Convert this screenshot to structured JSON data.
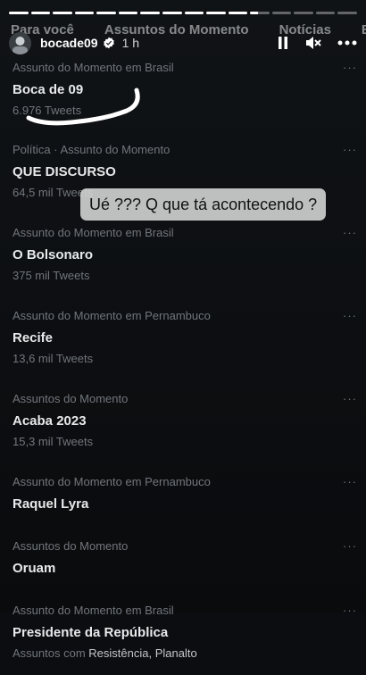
{
  "story": {
    "progress": [
      1,
      1,
      1,
      1,
      1,
      1,
      1,
      1,
      1,
      1,
      1,
      0.4,
      0,
      0,
      0,
      0
    ]
  },
  "background_tabs": [
    "Para você",
    "Assuntos do Momento",
    "Notícias",
    "Esp"
  ],
  "header": {
    "username": "bocade09",
    "time": "1 h",
    "verified": true
  },
  "trends": [
    {
      "meta": "Assunto do Momento em Brasil",
      "name": "Boca de 09",
      "count": "6.976 Tweets"
    },
    {
      "meta": "Política · Assunto do Momento",
      "name": "QUE DISCURSO",
      "count": "64,5 mil Tweets"
    },
    {
      "meta": "Assunto do Momento em Brasil",
      "name": "O Bolsonaro",
      "count": "375 mil Tweets"
    },
    {
      "meta": "Assunto do Momento em Pernambuco",
      "name": "Recife",
      "count": "13,6 mil Tweets"
    },
    {
      "meta": "Assuntos do Momento",
      "name": "Acaba 2023",
      "count": "15,3 mil Tweets"
    },
    {
      "meta": "Assunto do Momento em Pernambuco",
      "name": "Raquel Lyra",
      "count": ""
    },
    {
      "meta": "Assuntos do Momento",
      "name": "Oruam",
      "count": ""
    },
    {
      "meta": "Assunto do Momento em Brasil",
      "name": "Presidente da República",
      "count": ""
    }
  ],
  "last_trend_extra": {
    "prefix": "Assuntos com",
    "topics": "Resistência, Planalto"
  },
  "caption": "Ué ??? Q que tá acontecendo ?",
  "colors": {
    "background": "#0b0d10",
    "muted": "#71767b",
    "text": "#e7e9ea",
    "caption_bg": "#d7d7d7"
  }
}
